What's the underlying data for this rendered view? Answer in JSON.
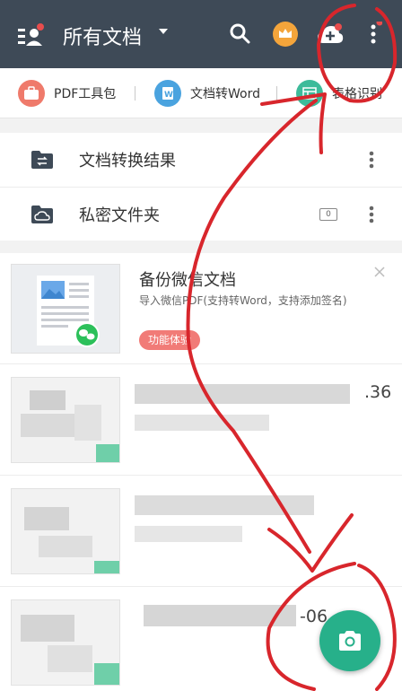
{
  "header": {
    "title": "所有文档",
    "icons": [
      "menu-icon",
      "search-icon",
      "crown-icon",
      "cloud-upload-icon",
      "more-icon"
    ]
  },
  "toolbar": {
    "items": [
      {
        "label": "PDF工具包",
        "icon": "toolbox-icon",
        "color": "#ef7a6b"
      },
      {
        "label": "文档转Word",
        "icon": "word-icon",
        "color": "#4aa3df"
      },
      {
        "label": "表格识别",
        "icon": "table-icon",
        "color": "#3dbb9a"
      }
    ]
  },
  "folders": [
    {
      "label": "文档转换结果",
      "icon": "convert-folder-icon"
    },
    {
      "label": "私密文件夹",
      "icon": "cloud-folder-icon",
      "count": "0"
    }
  ],
  "promo": {
    "title": "备份微信文档",
    "description": "导入微信PDF(支持转Word，支持添加签名)",
    "tag": "功能体验"
  },
  "documents": [
    {
      "meta": ".36"
    },
    {
      "meta": ""
    },
    {
      "meta": "-06"
    }
  ],
  "colors": {
    "header_bg": "#3e4a57",
    "fab": "#27b08a",
    "badge_red": "#e84d4d",
    "annotation_red": "#d8262c"
  }
}
